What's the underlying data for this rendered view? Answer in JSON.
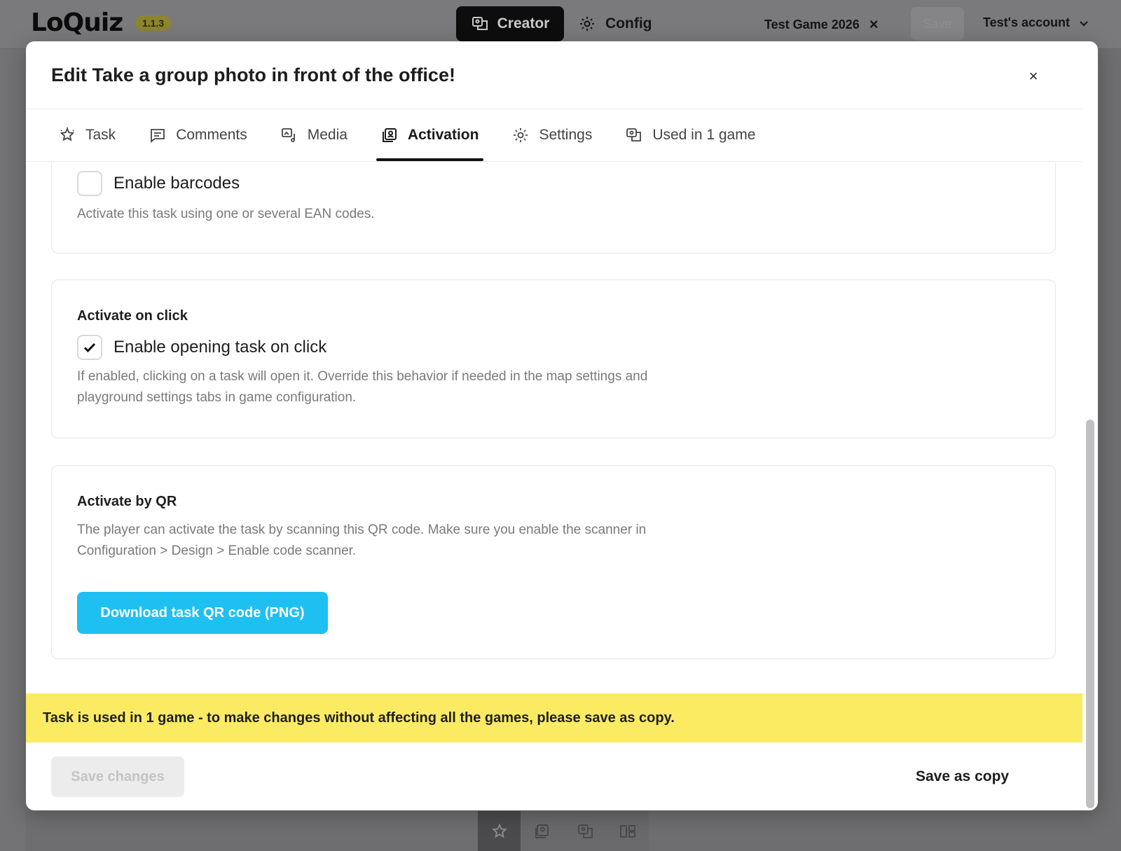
{
  "app": {
    "logo": "LoQuiz",
    "version": "1.1.3",
    "creator_label": "Creator",
    "config_label": "Config",
    "game_tab": "Test Game 2026",
    "game_tab_close": "×",
    "save_label": "Save",
    "account_label": "Test's account"
  },
  "modal": {
    "title": "Edit Take a group photo in front of the office!",
    "close": "×",
    "tabs": [
      {
        "label": "Task",
        "icon": "star-icon",
        "active": false
      },
      {
        "label": "Comments",
        "icon": "comment-icon",
        "active": false
      },
      {
        "label": "Media",
        "icon": "media-icon",
        "active": false
      },
      {
        "label": "Activation",
        "icon": "activation-icon",
        "active": true
      },
      {
        "label": "Settings",
        "icon": "gear-icon",
        "active": false
      },
      {
        "label": "Used in 1 game",
        "icon": "game-icon",
        "active": false
      }
    ],
    "barcodes": {
      "label": "Enable barcodes",
      "checked": false,
      "help": "Activate this task using one or several EAN codes."
    },
    "click": {
      "title": "Activate on click",
      "label": "Enable opening task on click",
      "checked": true,
      "help_line1": "If enabled, clicking on a task will open it. Override this behavior if needed in the map settings and",
      "help_line2": "playground settings tabs in game configuration."
    },
    "qr": {
      "title": "Activate by QR",
      "help_line1": "The player can activate the task by scanning this QR code. Make sure you enable the scanner in",
      "help_line2": "Configuration > Design > Enable code scanner.",
      "button": "Download task QR code (PNG)"
    },
    "warning": "Task is used in 1 game - to make changes without affecting all the games, please save as copy.",
    "save_changes": "Save changes",
    "save_as_copy": "Save as copy"
  },
  "colors": {
    "accent": "#1ec0f2",
    "warning": "#fbeb62",
    "version_badge": "#8c8430"
  }
}
